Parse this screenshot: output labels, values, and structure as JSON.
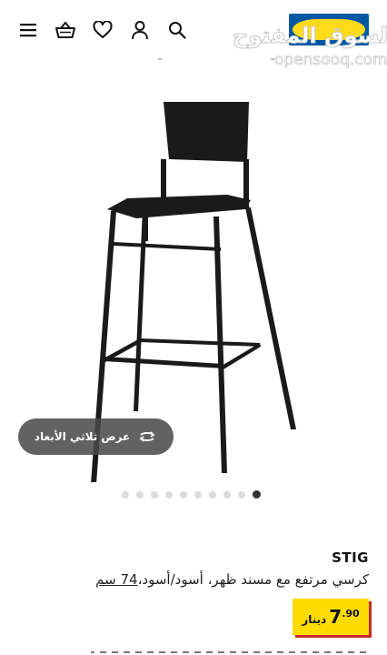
{
  "header": {
    "menu_icon": "hamburger-menu-icon",
    "cart_icon": "shopping-basket-icon",
    "wishlist_icon": "heart-icon",
    "account_icon": "person-icon",
    "search_icon": "search-icon",
    "brand_logo": "brand-logo"
  },
  "watermark": {
    "arabic": "السوق المفتوح",
    "latin": "opensooq.com"
  },
  "gallery": {
    "view_3d_label": "عرض ثلاثي الأبعاد",
    "view_3d_icon": "rotate-3d-icon",
    "dot_count": 10,
    "active_dot": 10
  },
  "product": {
    "name": "STIG",
    "description": "كرسي مرتفع مع مسند ظهر، أسود/أسود،",
    "size": "74 سم",
    "price_whole": "7",
    "price_decimal": ".90",
    "currency": "دينار"
  },
  "colors": {
    "price_tag": "#ffdb00",
    "price_shadow": "#c62b26",
    "brand_blue": "#0058a3",
    "brand_yellow": "#ffda1a"
  }
}
